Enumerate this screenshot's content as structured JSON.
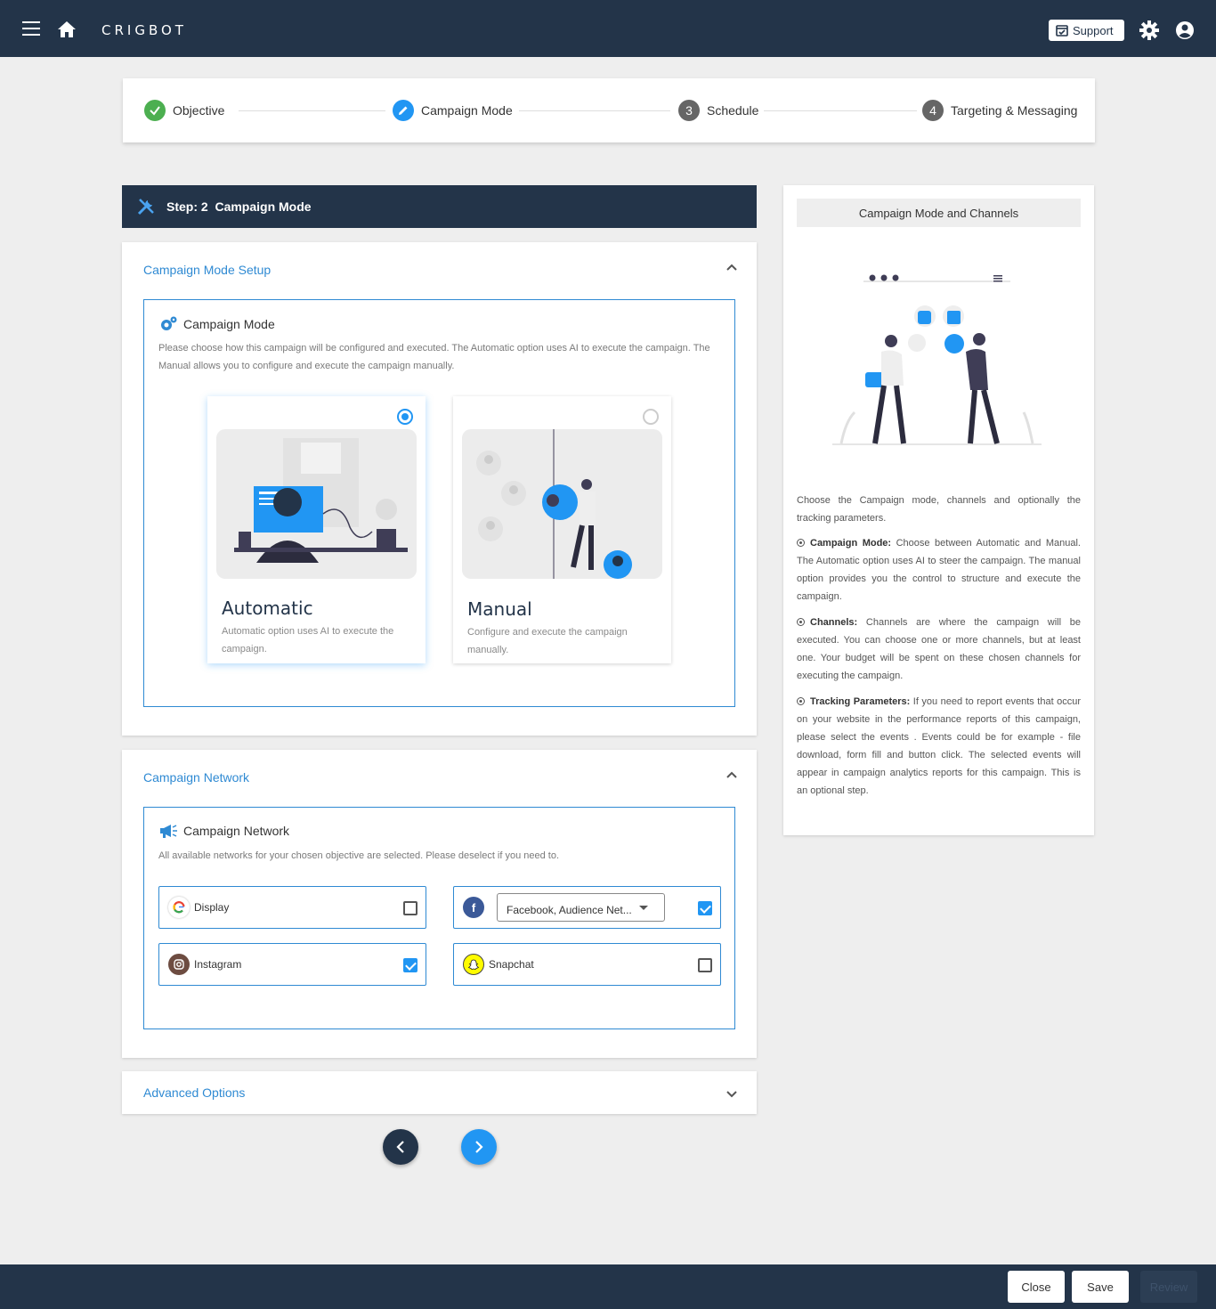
{
  "app": {
    "brand": "CRIGBOT",
    "support_label": "Support"
  },
  "stepper": {
    "steps": [
      {
        "label": "Objective",
        "marker": "check"
      },
      {
        "label": "Campaign Mode",
        "marker": "edit"
      },
      {
        "label": "Schedule",
        "marker": "3"
      },
      {
        "label": "Targeting & Messaging",
        "marker": "4"
      }
    ]
  },
  "step_header": {
    "label": "Step: 2  Campaign Mode"
  },
  "mode_setup": {
    "title": "Campaign Mode Setup",
    "box_title": "Campaign Mode",
    "description": "Please choose how this campaign will be configured and executed. The Automatic option uses AI to execute the campaign. The Manual allows you to configure and execute the campaign manually.",
    "options": [
      {
        "title": "Automatic",
        "description": "Automatic option uses AI to execute the campaign.",
        "selected": true
      },
      {
        "title": "Manual",
        "description": "Configure and execute the campaign manually.",
        "selected": false
      }
    ]
  },
  "network": {
    "title": "Campaign Network",
    "box_title": "Campaign Network",
    "description": "All available networks for your chosen objective are selected. Please deselect if you need to.",
    "items": [
      {
        "label": "Display",
        "checked": false,
        "icon": "google-icon"
      },
      {
        "label": "Facebook, Audience Net...",
        "checked": true,
        "icon": "facebook-icon"
      },
      {
        "label": "Instagram",
        "checked": true,
        "icon": "instagram-icon"
      },
      {
        "label": "Snapchat",
        "checked": false,
        "icon": "snapchat-icon"
      }
    ]
  },
  "advanced": {
    "title": "Advanced Options"
  },
  "info": {
    "title": "Campaign Mode and Channels",
    "intro": "Choose the Campaign mode, channels and optionally the tracking parameters.",
    "items": [
      {
        "term": "Campaign Mode:",
        "text": "Choose between Automatic and Manual. The Automatic option uses AI to steer the campaign. The manual option provides you the control to structure and execute the campaign."
      },
      {
        "term": "Channels:",
        "text": "Channels are where the campaign will be executed. You can choose one or more channels, but at least one. Your budget will be spent on these chosen channels for executing the campaign."
      },
      {
        "term": "Tracking Parameters:",
        "text": "If you need to report events that occur on your website in the performance reports of this campaign, please select the events . Events could be for example - file download, form fill and button click. The selected events will appear in campaign analytics reports for this campaign. This is an optional step."
      }
    ]
  },
  "footer": {
    "close": "Close",
    "save": "Save",
    "review": "Review"
  },
  "colors": {
    "navy": "#233449",
    "accent": "#2196f3",
    "link": "#2f8ad3",
    "success": "#4caf50"
  }
}
